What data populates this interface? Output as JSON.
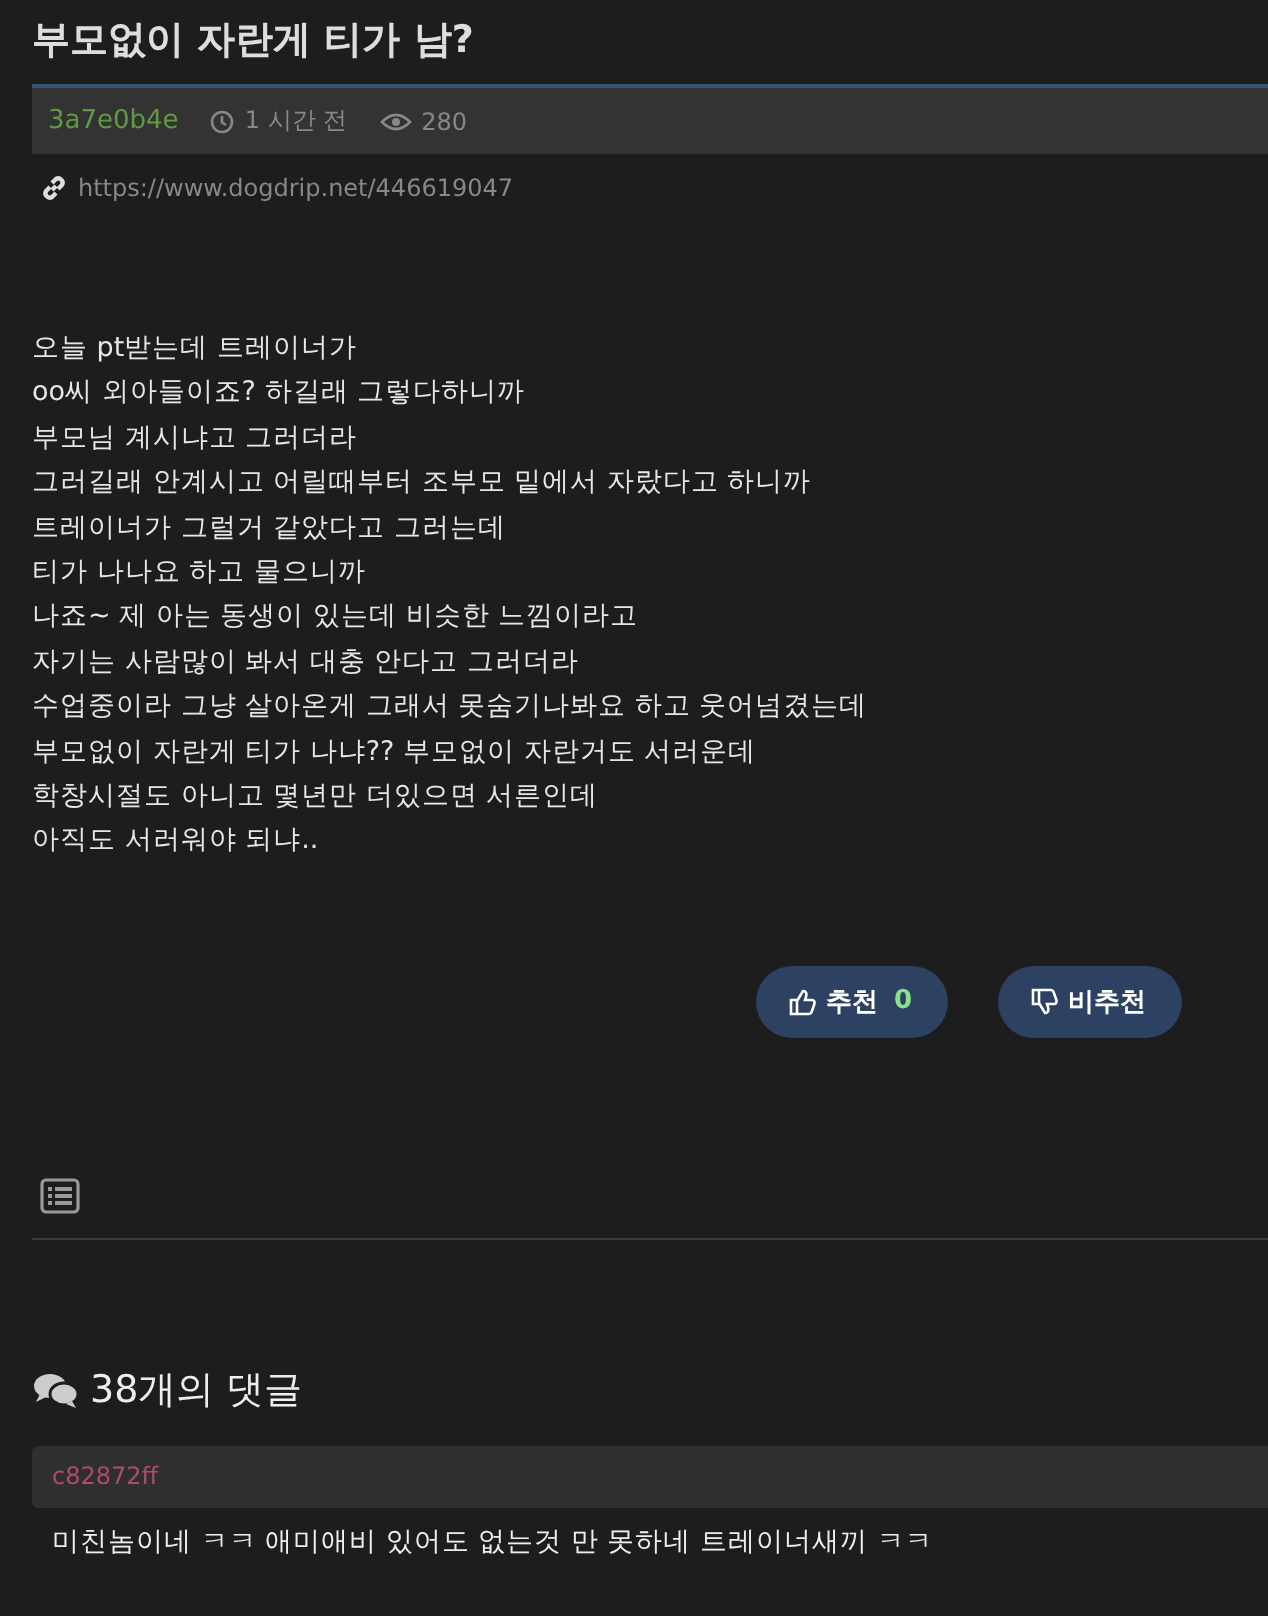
{
  "post": {
    "title": "부모없이 자란게 티가 남?",
    "author": "3a7e0b4e",
    "time": "1 시간 전",
    "views": "280",
    "url": "https://www.dogdrip.net/446619047",
    "body": [
      "오늘 pt받는데 트레이너가",
      "oo씨 외아들이죠? 하길래 그렇다하니까",
      "부모님 계시냐고 그러더라",
      "그러길래 안계시고 어릴때부터 조부모 밑에서 자랐다고 하니까",
      "트레이너가 그럴거 같았다고 그러는데",
      "티가 나나요 하고 물으니까",
      "나죠~ 제 아는 동생이 있는데 비슷한 느낌이라고",
      "자기는 사람많이 봐서 대충 안다고 그러더라",
      "수업중이라 그냥 살아온게 그래서 못숨기나봐요 하고 웃어넘겼는데",
      "부모없이 자란게 티가 나냐?? 부모없이 자란거도 서러운데",
      "학창시절도 아니고 몇년만 더있으면 서른인데",
      "아직도 서러워야 되냐.."
    ],
    "votes": [
      {
        "kind": "up",
        "label": "추천",
        "count": "0"
      },
      {
        "kind": "down",
        "label": "비추천"
      }
    ]
  },
  "comments": {
    "heading": "38개의 댓글",
    "items": [
      {
        "author": "c82872ff",
        "text": "미친놈이네 ㅋㅋ 애미애비 있어도 없는것 만 못하네 트레이너새끼 ㅋㅋ"
      }
    ]
  }
}
